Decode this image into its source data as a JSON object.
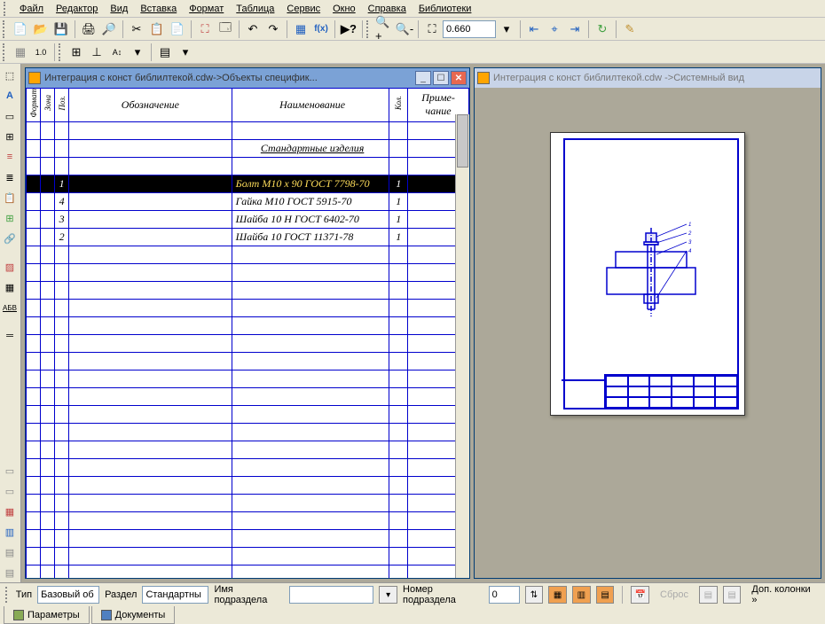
{
  "menu": [
    "Файл",
    "Редактор",
    "Вид",
    "Вставка",
    "Формат",
    "Таблица",
    "Сервис",
    "Окно",
    "Справка",
    "Библиотеки"
  ],
  "zoom": "0.660",
  "doc_left": {
    "title": "Интеграция с конст библилтекой.cdw->Объекты специфик...",
    "headers": {
      "format": "Формат",
      "zone": "Зона",
      "pos": "Поз.",
      "desig": "Обозначение",
      "name": "Наименование",
      "kol": "Кол.",
      "note": "Приме-\nчание"
    },
    "section_title": "Стандартные изделия",
    "rows": [
      {
        "pos": "1",
        "name": "Болт М10 x 90 ГОСТ 7798-70",
        "kol": "1",
        "selected": true
      },
      {
        "pos": "4",
        "name": "Гайка М10 ГОСТ 5915-70",
        "kol": "1",
        "selected": false
      },
      {
        "pos": "3",
        "name": "Шайба 10 Н ГОСТ 6402-70",
        "kol": "1",
        "selected": false
      },
      {
        "pos": "2",
        "name": "Шайба 10 ГОСТ 11371-78",
        "kol": "1",
        "selected": false
      }
    ]
  },
  "doc_right": {
    "title": "Интеграция с конст библилтекой.cdw ->Системный вид"
  },
  "params": {
    "type_label": "Тип",
    "type_value": "Базовый об",
    "section_label": "Раздел",
    "section_value": "Стандартны",
    "subname_label": "Имя подраздела",
    "subname_value": "",
    "subnum_label": "Номер подраздела",
    "subnum_value": "0",
    "reset": "Сброс",
    "extra_cols": "Доп. колонки  »"
  },
  "tabs": {
    "params": "Параметры",
    "docs": "Документы"
  }
}
